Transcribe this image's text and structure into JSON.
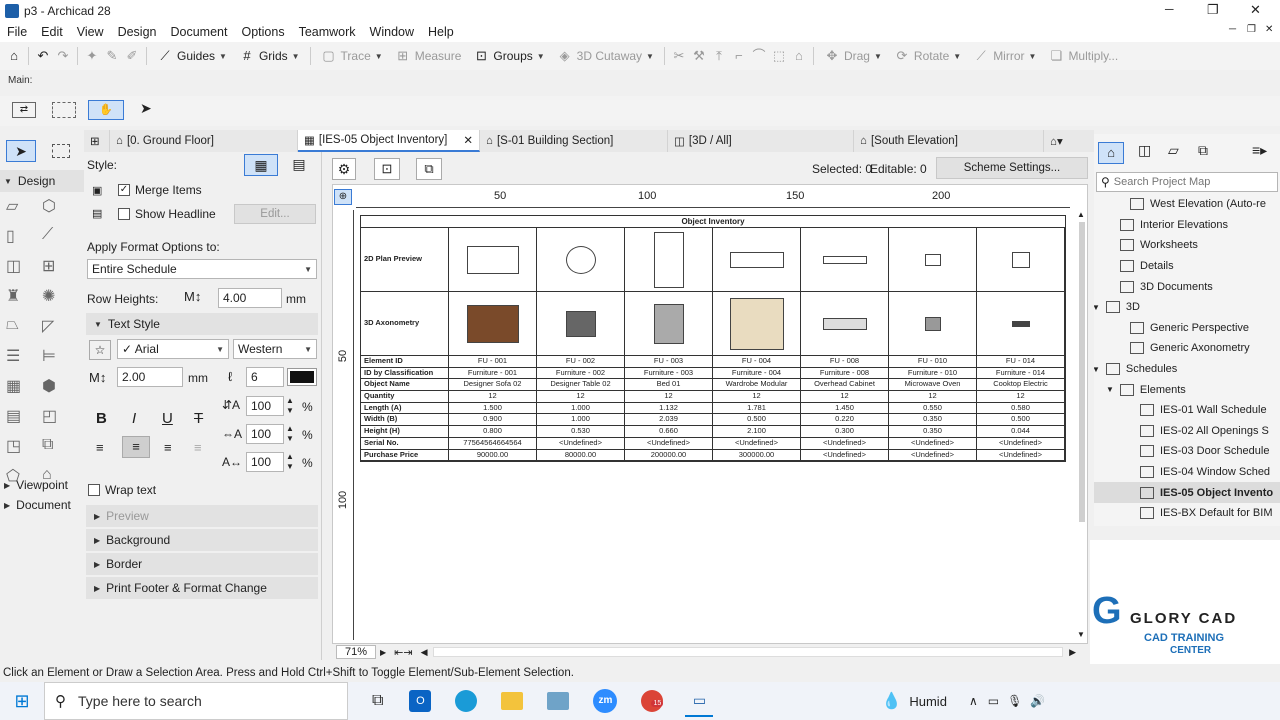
{
  "window": {
    "title": "p3 - Archicad 28",
    "minimize": "─",
    "restore": "❐",
    "close": "✕"
  },
  "menu": [
    "File",
    "Edit",
    "View",
    "Design",
    "Document",
    "Options",
    "Teamwork",
    "Window",
    "Help"
  ],
  "toolbar": {
    "guides": "Guides",
    "grids": "Grids",
    "trace": "Trace",
    "measure": "Measure",
    "groups": "Groups",
    "cutaway": "3D Cutaway",
    "drag": "Drag",
    "rotate": "Rotate",
    "mirror": "Mirror",
    "multiply": "Multiply..."
  },
  "info_label": "Main:",
  "toolbox": {
    "design": "Design",
    "viewpoint": "Viewpoint",
    "document": "Document"
  },
  "panel": {
    "style": "Style:",
    "merge_items": "Merge Items",
    "show_headline": "Show Headline",
    "edit": "Edit...",
    "apply_format": "Apply Format Options to:",
    "apply_value": "Entire Schedule",
    "row_heights": "Row Heights:",
    "row_height_value": "4.00",
    "unit_mm": "mm",
    "text_style": "Text Style",
    "font": "Arial",
    "script": "Western",
    "font_size": "2.00",
    "pen": "6",
    "spacing1": "100",
    "spacing2": "100",
    "spacing3": "100",
    "percent": "%",
    "wrap_text": "Wrap text",
    "preview": "Preview",
    "background": "Background",
    "border": "Border",
    "print_footer": "Print Footer & Format Change"
  },
  "tabs": [
    "[0. Ground Floor]",
    "[IES-05 Object Inventory]",
    "[S-01 Building Section]",
    "[3D / All]",
    "[South Elevation]"
  ],
  "canvas_header": {
    "selected": "Selected: 0",
    "editable": "Editable: 0",
    "scheme": "Scheme Settings..."
  },
  "ruler": {
    "top": [
      "50",
      "100",
      "150",
      "200"
    ],
    "left": [
      "50",
      "100"
    ]
  },
  "schedule": {
    "title": "Object Inventory",
    "row_labels": [
      "2D Plan Preview",
      "3D Axonometry",
      "Element ID",
      "ID by Classification",
      "Object Name",
      "Quantity",
      "Length (A)",
      "Width (B)",
      "Height (H)",
      "Serial No.",
      "Purchase Price"
    ],
    "columns": [
      [
        "FU - 001",
        "Furniture - 001",
        "Designer Sofa 02",
        "12",
        "1.500",
        "0.900",
        "0.800",
        "77564564664564",
        "90000.00"
      ],
      [
        "FU - 002",
        "Furniture - 002",
        "Designer Table 02",
        "12",
        "1.000",
        "1.000",
        "0.530",
        "<Undefined>",
        "80000.00"
      ],
      [
        "FU - 003",
        "Furniture - 003",
        "Bed 01",
        "12",
        "1.132",
        "2.039",
        "0.660",
        "<Undefined>",
        "200000.00"
      ],
      [
        "FU - 004",
        "Furniture - 004",
        "Wardrobe Modular",
        "12",
        "1.781",
        "0.500",
        "2.100",
        "<Undefined>",
        "300000.00"
      ],
      [
        "FU - 008",
        "Furniture - 008",
        "Overhead Cabinet",
        "12",
        "1.450",
        "0.220",
        "0.300",
        "<Undefined>",
        "<Undefined>"
      ],
      [
        "FU - 010",
        "Furniture - 010",
        "Microwave Oven",
        "12",
        "0.550",
        "0.350",
        "0.350",
        "<Undefined>",
        "<Undefined>"
      ],
      [
        "FU - 014",
        "Furniture - 014",
        "Cooktop Electric",
        "12",
        "0.580",
        "0.500",
        "0.044",
        "<Undefined>",
        "<Undefined>"
      ]
    ]
  },
  "zoom": "71%",
  "navigator": {
    "search_placeholder": "Search Project Map",
    "items": [
      "West Elevation (Auto-re",
      "Interior Elevations",
      "Worksheets",
      "Details",
      "3D Documents",
      "3D",
      "Generic Perspective",
      "Generic Axonometry",
      "Schedules",
      "Elements",
      "IES-01 Wall Schedule",
      "IES-02 All Openings S",
      "IES-03 Door Schedule",
      "IES-04 Window Sched",
      "IES-05 Object Invento",
      "IES-BX Default for BIM"
    ]
  },
  "status": "Click an Element or Draw a Selection Area. Press and Hold Ctrl+Shift to Toggle Element/Sub-Element Selection.",
  "taskbar": {
    "search": "Type here to search",
    "weather": "Humid",
    "badge": "15",
    "zoom_app": "zm"
  },
  "logo": {
    "line1": "GLORY CAD",
    "line2": "CAD TRAINING",
    "line3": "CENTER"
  }
}
